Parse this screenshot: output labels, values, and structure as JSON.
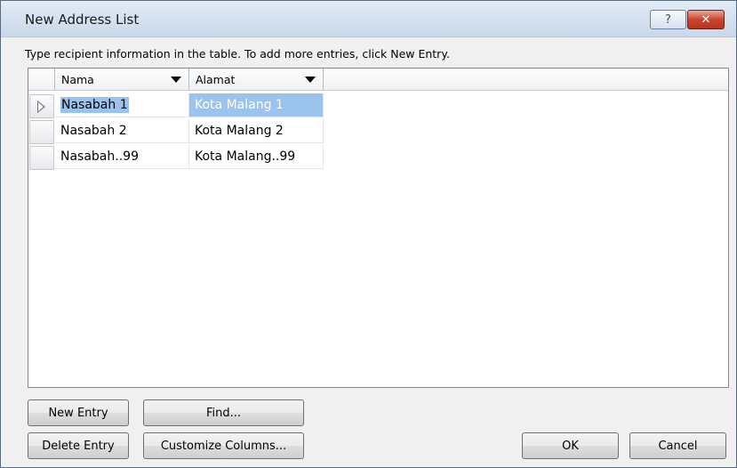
{
  "window": {
    "title": "New Address List"
  },
  "titlebar": {
    "help_label": "?",
    "close_label": "✕"
  },
  "instruction": "Type recipient information in the table.  To add more entries, click New Entry.",
  "table": {
    "columns": [
      "Nama",
      "Alamat"
    ],
    "rows": [
      {
        "nama": "Nasabah 1",
        "alamat": "Kota Malang 1"
      },
      {
        "nama": "Nasabah 2",
        "alamat": "Kota Malang 2"
      },
      {
        "nama": "Nasabah..99",
        "alamat": "Kota Malang..99"
      }
    ]
  },
  "buttons": {
    "new_entry": "New Entry",
    "find": "Find...",
    "delete_entry": "Delete Entry",
    "customize_columns": "Customize Columns...",
    "ok": "OK",
    "cancel": "Cancel"
  },
  "colors": {
    "selection": "#9cc3ec",
    "close": "#c9452e"
  }
}
